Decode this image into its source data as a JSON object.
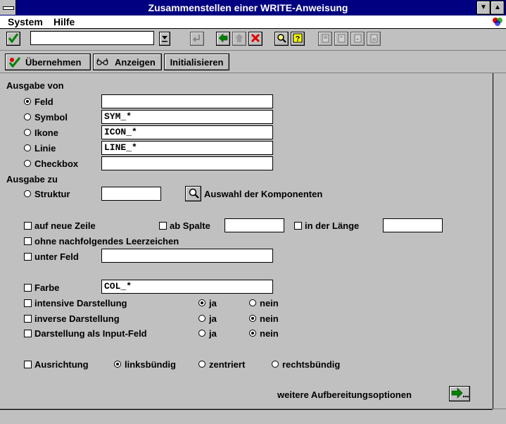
{
  "window": {
    "title": "Zusammenstellen einer WRITE-Anweisung"
  },
  "menu": {
    "system_label": "System",
    "help_label": "Hilfe"
  },
  "toolbar": {
    "command_value": "",
    "icons": [
      "check-icon",
      "dropdown-arrow-icon",
      "save-icon",
      "back-arrow-icon",
      "up-arrow-icon",
      "cancel-x-icon",
      "find-icon",
      "help-icon",
      "first-page-icon",
      "prev-page-icon",
      "next-page-icon",
      "last-page-icon"
    ]
  },
  "appbar": {
    "apply_label": "Übernehmen",
    "display_label": "Anzeigen",
    "init_label": "Initialisieren"
  },
  "form": {
    "output_from_heading": "Ausgabe von",
    "options": [
      {
        "label": "Feld",
        "value": "",
        "selected": true
      },
      {
        "label": "Symbol",
        "value": "SYM_*",
        "selected": false
      },
      {
        "label": "Ikone",
        "value": "ICON_*",
        "selected": false
      },
      {
        "label": "Linie",
        "value": "LINE_*",
        "selected": false
      },
      {
        "label": "Checkbox",
        "value": "",
        "selected": false
      }
    ],
    "output_to_heading": "Ausgabe zu",
    "structure_label": "Struktur",
    "structure_value": "",
    "components_label": "Auswahl der Komponenten",
    "new_line_label": "auf neue Zeile",
    "from_column_label": "ab Spalte",
    "from_column_value": "",
    "length_label": "in der Länge",
    "length_value": "",
    "no_space_label": "ohne nachfolgendes Leerzeichen",
    "under_field_label": "unter Feld",
    "under_field_value": "",
    "color_label": "Farbe",
    "color_value": "COL_*",
    "intensive_label": "intensive Darstellung",
    "inverse_label": "inverse Darstellung",
    "input_field_label": "Darstellung als Input-Feld",
    "ja_label": "ja",
    "nein_label": "nein",
    "intensive_selected": "ja",
    "inverse_selected": "nein",
    "input_selected": "nein",
    "alignment_label": "Ausrichtung",
    "left_label": "linksbündig",
    "center_label": "zentriert",
    "right_label": "rechtsbündig",
    "alignment_selected": "left",
    "more_options_label": "weitere Aufbereitungsoptionen"
  }
}
